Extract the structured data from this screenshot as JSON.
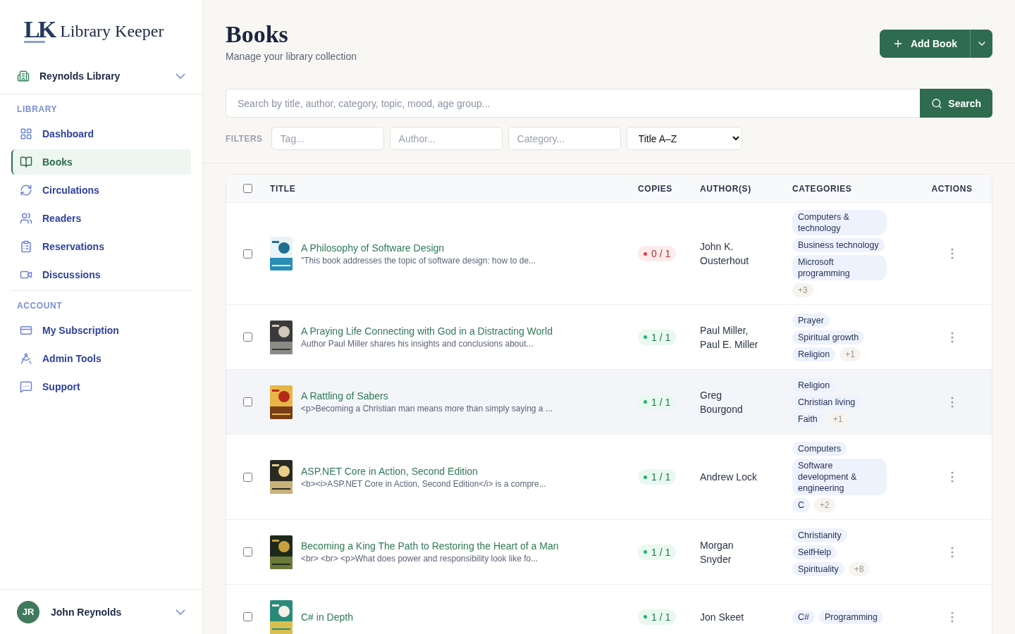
{
  "brand": {
    "mark": "LK",
    "name": "Library Keeper"
  },
  "library_switcher": {
    "label": "Reynolds Library"
  },
  "nav_sections": [
    {
      "heading": "LIBRARY",
      "items": [
        {
          "label": "Dashboard",
          "selected": false
        },
        {
          "label": "Books",
          "selected": true
        },
        {
          "label": "Circulations",
          "selected": false
        },
        {
          "label": "Readers",
          "selected": false
        },
        {
          "label": "Reservations",
          "selected": false
        },
        {
          "label": "Discussions",
          "selected": false
        }
      ]
    },
    {
      "heading": "ACCOUNT",
      "items": [
        {
          "label": "My Subscription",
          "selected": false
        },
        {
          "label": "Admin Tools",
          "selected": false
        },
        {
          "label": "Support",
          "selected": false
        }
      ]
    }
  ],
  "user": {
    "initials": "JR",
    "name": "John Reynolds"
  },
  "page": {
    "title": "Books",
    "subtitle": "Manage your library collection",
    "add_button": "Add Book"
  },
  "search": {
    "placeholder": "Search by title, author, category, topic, mood, age group...",
    "button": "Search"
  },
  "filters": {
    "label": "FILTERS",
    "tag_placeholder": "Tag...",
    "author_placeholder": "Author...",
    "category_placeholder": "Category...",
    "sort": "Title A–Z"
  },
  "table": {
    "select_all_checked": false,
    "columns": [
      "TITLE",
      "COPIES",
      "AUTHOR(S)",
      "CATEGORIES",
      "ACTIONS"
    ],
    "rows": [
      {
        "title": "A Philosophy of Software Design",
        "description": "\"This book addresses the topic of software design: how to de...",
        "copies": "0 / 1",
        "available": false,
        "authors": "John K. Ousterhout",
        "categories": [
          {
            "kind": "tag",
            "label": "Computers & technology"
          },
          {
            "kind": "tag",
            "label": "Business technology"
          },
          {
            "kind": "tag",
            "label": "Microsoft programming"
          },
          {
            "kind": "more",
            "label": "+3"
          }
        ],
        "highlighted": false,
        "checked": false
      },
      {
        "title": "A Praying Life Connecting with God in a Distracting World",
        "description": "Author Paul Miller shares his insights and conclusions about...",
        "copies": "1 / 1",
        "available": true,
        "authors": "Paul Miller, Paul E. Miller",
        "categories": [
          {
            "kind": "tag",
            "label": "Prayer"
          },
          {
            "kind": "tag",
            "label": "Spiritual growth"
          },
          {
            "kind": "tag",
            "label": "Religion"
          },
          {
            "kind": "more",
            "label": "+1"
          }
        ],
        "highlighted": false,
        "checked": false
      },
      {
        "title": "A Rattling of Sabers",
        "description": "<p>Becoming a Christian man means more than simply saying a ...",
        "copies": "1 / 1",
        "available": true,
        "authors": "Greg Bourgond",
        "categories": [
          {
            "kind": "tag",
            "label": "Religion"
          },
          {
            "kind": "tag",
            "label": "Christian living"
          },
          {
            "kind": "tag",
            "label": "Faith"
          },
          {
            "kind": "more",
            "label": "+1"
          }
        ],
        "highlighted": true,
        "checked": false
      },
      {
        "title": "ASP.NET Core in Action, Second Edition",
        "description": "<b><i>ASP.NET Core in Action, Second Edition</i> is a compre...",
        "copies": "1 / 1",
        "available": true,
        "authors": "Andrew Lock",
        "categories": [
          {
            "kind": "tag",
            "label": "Computers"
          },
          {
            "kind": "tag",
            "label": "Software development & engineering"
          },
          {
            "kind": "tag",
            "label": "C"
          },
          {
            "kind": "more",
            "label": "+2"
          }
        ],
        "highlighted": false,
        "checked": false
      },
      {
        "title": "Becoming a King The Path to Restoring the Heart of a Man",
        "description": "<br> <br> <p>What does power and responsibility look like fo...",
        "copies": "1 / 1",
        "available": true,
        "authors": "Morgan Snyder",
        "categories": [
          {
            "kind": "tag",
            "label": "Christianity"
          },
          {
            "kind": "tag",
            "label": "SelfHelp"
          },
          {
            "kind": "tag",
            "label": "Spirituality"
          },
          {
            "kind": "more",
            "label": "+8"
          }
        ],
        "highlighted": false,
        "checked": false
      },
      {
        "title": "C# in Depth",
        "copies": "1 / 1",
        "available": true,
        "authors": "Jon Skeet",
        "categories": [
          {
            "kind": "tag",
            "label": "C#"
          },
          {
            "kind": "tag",
            "label": "Programming"
          }
        ],
        "highlighted": false,
        "checked": false
      }
    ]
  }
}
